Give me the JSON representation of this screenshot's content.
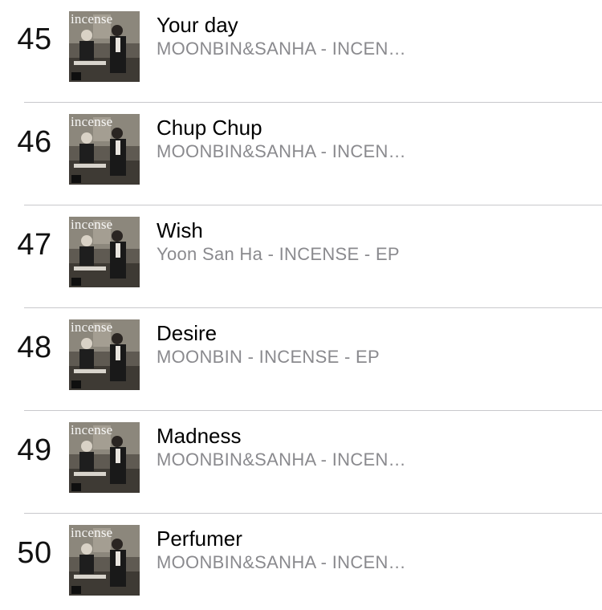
{
  "songs": [
    {
      "rank": "45",
      "title": "Your day",
      "subtitle": "MOONBIN&SANHA - INCEN…",
      "cover_text": "incense"
    },
    {
      "rank": "46",
      "title": "Chup Chup",
      "subtitle": "MOONBIN&SANHA - INCEN…",
      "cover_text": "incense"
    },
    {
      "rank": "47",
      "title": "Wish",
      "subtitle": "Yoon San Ha - INCENSE - EP",
      "cover_text": "incense"
    },
    {
      "rank": "48",
      "title": "Desire",
      "subtitle": "MOONBIN - INCENSE - EP",
      "cover_text": "incense"
    },
    {
      "rank": "49",
      "title": "Madness",
      "subtitle": "MOONBIN&SANHA - INCEN…",
      "cover_text": "incense"
    },
    {
      "rank": "50",
      "title": "Perfumer",
      "subtitle": "MOONBIN&SANHA - INCEN…",
      "cover_text": "incense"
    }
  ],
  "colors": {
    "title": "#000000",
    "subtitle": "#8a8a8e",
    "separator": "#c8c8cc"
  }
}
